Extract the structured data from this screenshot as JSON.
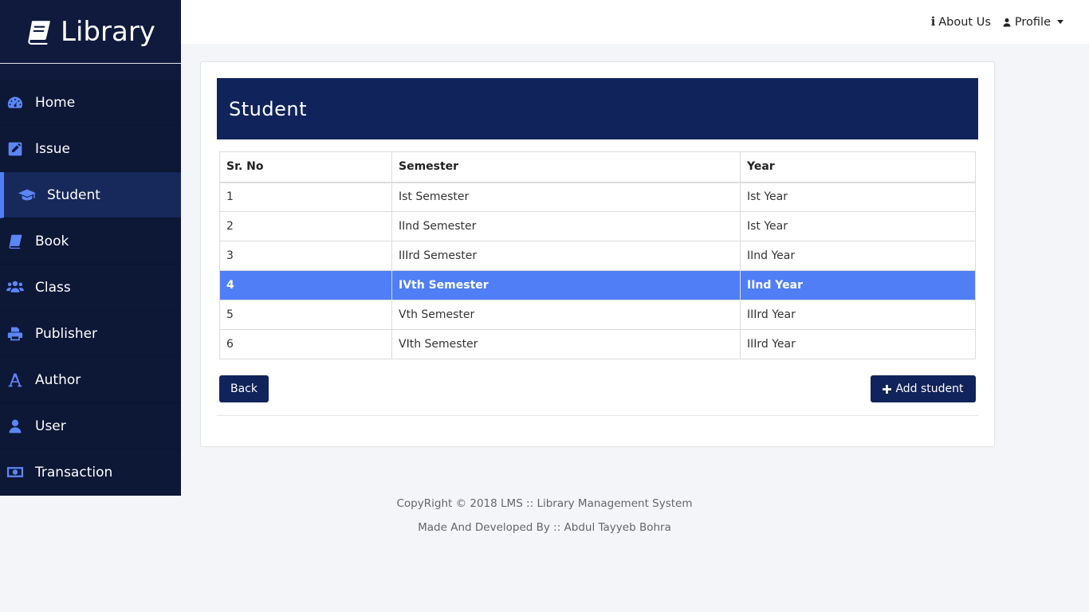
{
  "brand": {
    "title": "Library",
    "icon": "book-icon"
  },
  "sidebar": {
    "items": [
      {
        "label": "Home",
        "icon": "dashboard-icon",
        "active": false
      },
      {
        "label": "Issue",
        "icon": "edit-icon",
        "active": false
      },
      {
        "label": "Student",
        "icon": "graduation-cap-icon",
        "active": true
      },
      {
        "label": "Book",
        "icon": "book-icon",
        "active": false
      },
      {
        "label": "Class",
        "icon": "users-icon",
        "active": false
      },
      {
        "label": "Publisher",
        "icon": "print-icon",
        "active": false
      },
      {
        "label": "Author",
        "icon": "font-icon",
        "active": false
      },
      {
        "label": "User",
        "icon": "user-icon",
        "active": false
      },
      {
        "label": "Transaction",
        "icon": "money-icon",
        "active": false
      }
    ]
  },
  "topbar": {
    "about": "About Us",
    "profile": "Profile"
  },
  "main": {
    "title": "Student",
    "table": {
      "headers": [
        "Sr. No",
        "Semester",
        "Year"
      ],
      "rows": [
        [
          "1",
          "Ist Semester",
          "Ist Year"
        ],
        [
          "2",
          "IInd Semester",
          "Ist Year"
        ],
        [
          "3",
          "IIIrd Semester",
          "IInd Year"
        ],
        [
          "4",
          "IVth Semester",
          "IInd Year"
        ],
        [
          "5",
          "Vth Semester",
          "IIIrd Year"
        ],
        [
          "6",
          "VIth Semester",
          "IIIrd Year"
        ]
      ],
      "selected_row": 3
    },
    "back_label": "Back",
    "add_label": "Add student"
  },
  "footer": {
    "line1": "CopyRight © 2018 LMS :: Library Management System",
    "line2": "Made And Developed By :: Abdul Tayyeb Bohra"
  },
  "colors": {
    "sidebar": "#0f1a3d",
    "accent": "#4f7ef7",
    "header": "#10235a"
  }
}
